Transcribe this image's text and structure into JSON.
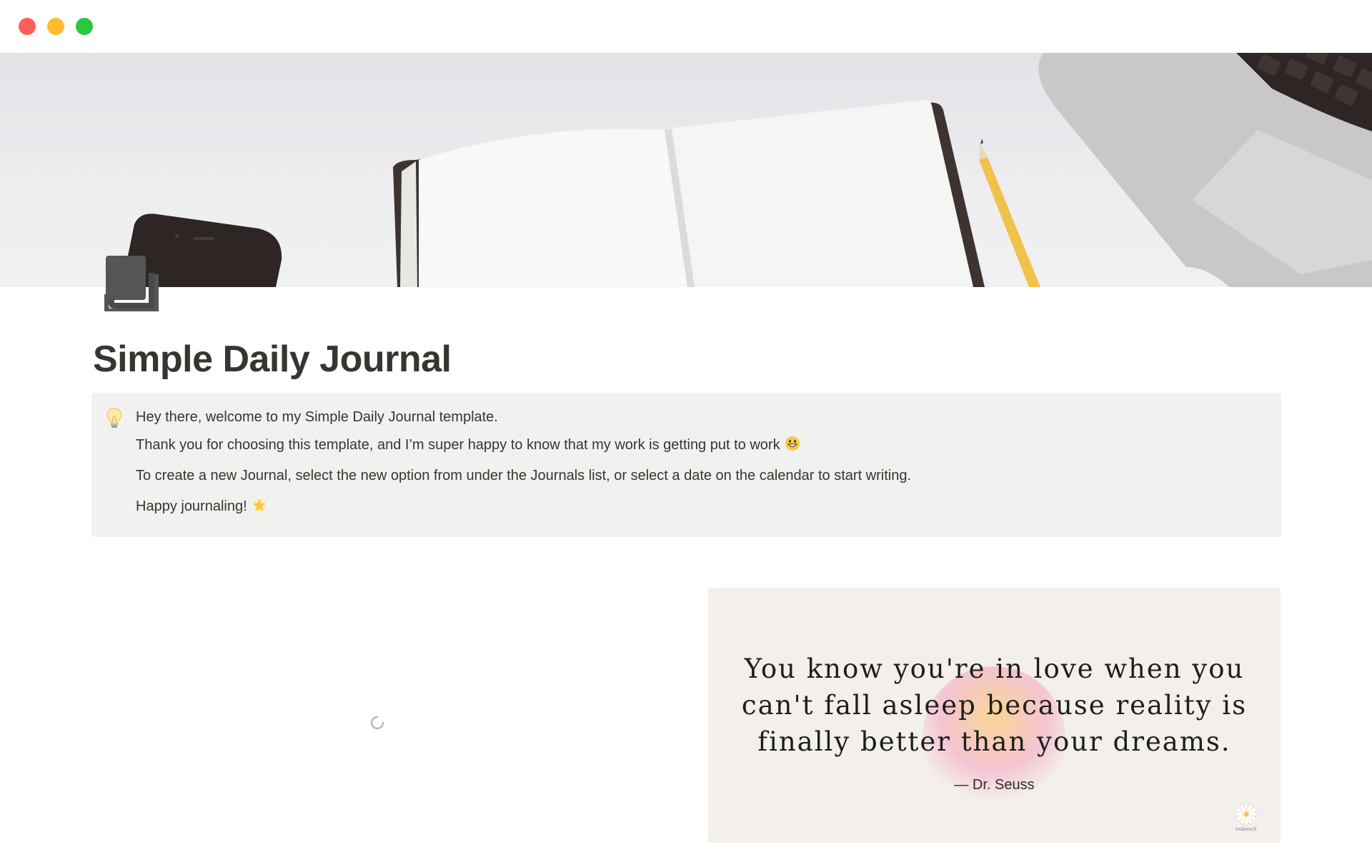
{
  "page": {
    "title": "Simple Daily Journal",
    "icon": "document-icon"
  },
  "cover": {
    "icon": "desk-notebook-cover-image"
  },
  "callout": {
    "icon": "light-bulb-icon",
    "lines": [
      "Hey there, welcome to my Simple Daily Journal template.",
      "Thank you for choosing this template, and I’m super happy to know that my work is getting put to work",
      "To create a new Journal, select the new option from under the Journals list, or select a date on the calendar to start writing.",
      "Happy journaling!"
    ],
    "line2_emoji": "grinning-face-icon",
    "line4_emoji": "glowing-star-icon",
    "background": "#f1f1ef"
  },
  "loading": {
    "icon": "loading-spinner-icon"
  },
  "quote": {
    "text": "You know you're in love when you can't fall asleep because reality is finally better than your dreams.",
    "author": "— Dr. Seuss",
    "logo_text": "eukeach",
    "background": "#f3efea"
  },
  "colors": {
    "text": "#37352f",
    "close": "#fe5f57",
    "minimize": "#febc2e",
    "maximize": "#28c840"
  }
}
